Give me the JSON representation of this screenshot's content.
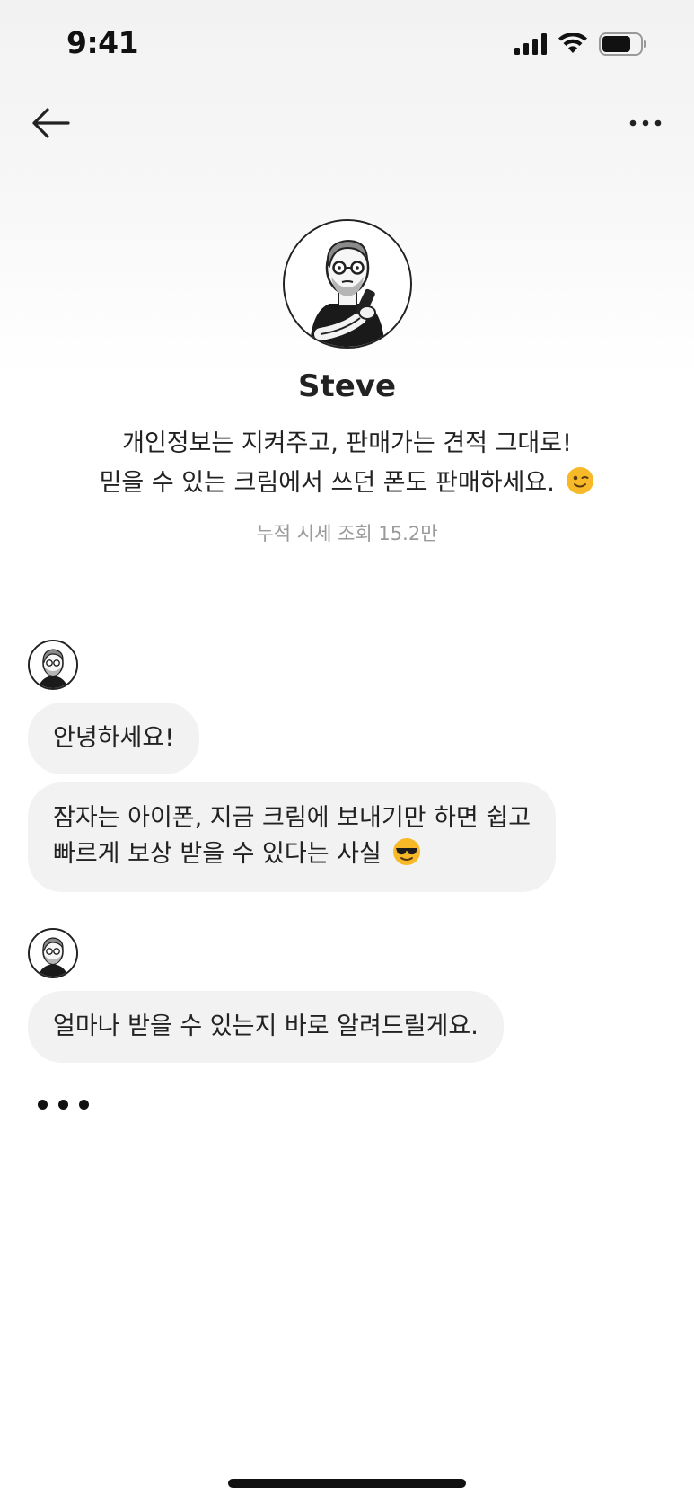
{
  "status_bar": {
    "time": "9:41",
    "battery_level": 0.75
  },
  "nav": {
    "back_icon": "arrow-left-icon",
    "more_icon": "ellipsis-icon"
  },
  "profile": {
    "name": "Steve",
    "description_line1": "개인정보는 지켜주고, 판매가는 견적 그대로!",
    "description_line2": "믿을 수 있는 크림에서 쓰던 폰도 판매하세요.",
    "description_emoji": "winking-face",
    "meta": "누적 시세 조회 15.2만"
  },
  "chat": {
    "groups": [
      {
        "messages": [
          {
            "text": "안녕하세요!"
          },
          {
            "line1": "잠자는 아이폰, 지금 크림에 보내기만 하면 쉽고",
            "line2": "빠르게 보상 받을 수 있다는 사실",
            "emoji": "smiling-face-with-sunglasses"
          }
        ]
      },
      {
        "messages": [
          {
            "text": "얼마나 받을 수 있는지 바로 알려드릴게요."
          }
        ]
      }
    ],
    "typing_indicator": true
  },
  "colors": {
    "bubble": "#f2f2f2",
    "text": "#222222",
    "meta": "#9a9a9a",
    "emoji_yellow": "#f7b928"
  }
}
